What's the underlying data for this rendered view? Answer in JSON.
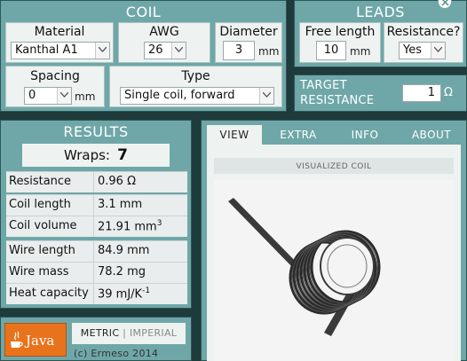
{
  "coil": {
    "title": "COIL",
    "material": {
      "label": "Material",
      "value": "Kanthal A1"
    },
    "awg": {
      "label": "AWG",
      "value": "26"
    },
    "diameter": {
      "label": "Diameter",
      "value": "3",
      "unit": "mm"
    },
    "spacing": {
      "label": "Spacing",
      "value": "0",
      "unit": "mm"
    },
    "type": {
      "label": "Type",
      "value": "Single coil, forward"
    }
  },
  "leads": {
    "title": "LEADS",
    "free_length": {
      "label": "Free length",
      "value": "10",
      "unit": "mm"
    },
    "resistance": {
      "label": "Resistance?",
      "value": "Yes"
    }
  },
  "target": {
    "label_line1": "TARGET",
    "label_line2": "RESISTANCE",
    "value": "1",
    "unit": "Ω"
  },
  "results": {
    "title": "RESULTS",
    "wraps_label": "Wraps:",
    "wraps_value": "7",
    "rows": [
      {
        "key": "Resistance",
        "value": "0.96 Ω"
      },
      {
        "key": "Coil length",
        "value": "3.1 mm"
      },
      {
        "key": "Coil volume",
        "value": "21.91 mm",
        "sup": "3"
      },
      {
        "key": "Wire length",
        "value": "84.9 mm"
      },
      {
        "key": "Wire mass",
        "value": "78.2 mg"
      },
      {
        "key": "Heat capacity",
        "value": "39 mJ/K",
        "sup": "-1"
      }
    ]
  },
  "tabs": [
    "VIEW",
    "EXTRA",
    "INFO",
    "ABOUT"
  ],
  "visual": {
    "caption": "VISUALIZED COIL"
  },
  "footer": {
    "java_label": "Java",
    "metric": "METRIC",
    "separator": "|",
    "imperial": "IMPERIAL",
    "copyright": "(c) Ermeso 2014"
  },
  "colors": {
    "background": "#1f3a3a",
    "panel": "#6fa7a8",
    "box": "#eef2f1",
    "coil": "#2b2b2b",
    "java_orange": "#e8731c"
  }
}
